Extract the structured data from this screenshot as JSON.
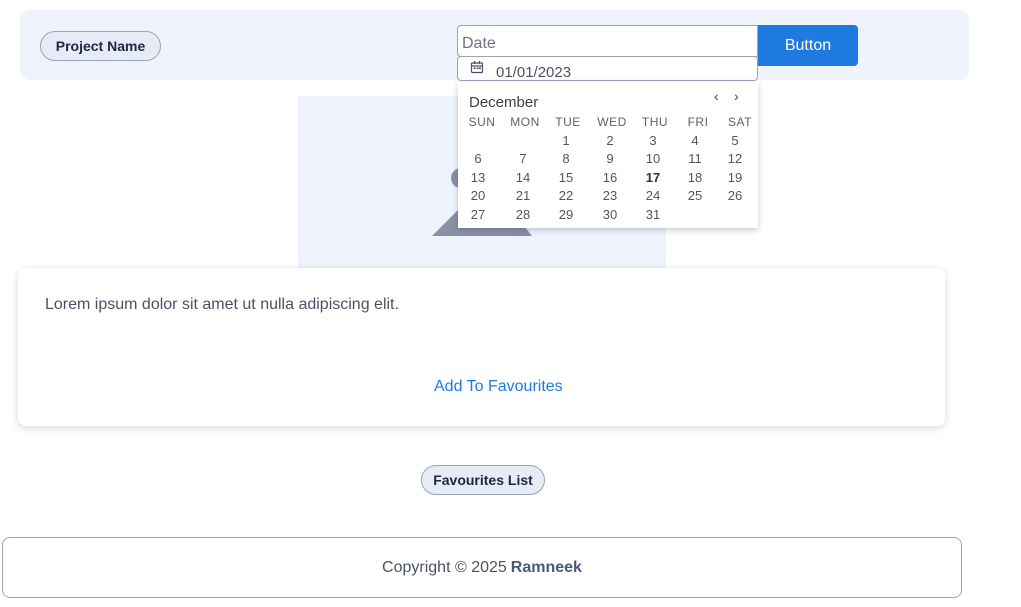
{
  "header": {
    "project_name": "Project Name",
    "date_placeholder": "Date",
    "button_label": "Button"
  },
  "date_picker": {
    "value": "01/01/2023",
    "month": "December",
    "prev_icon": "chevron-left-icon",
    "next_icon": "chevron-right-icon",
    "weekdays": [
      "SUN",
      "MON",
      "TUE",
      "WED",
      "THU",
      "FRI",
      "SAT"
    ],
    "days": [
      "1",
      "2",
      "3",
      "4",
      "5",
      "6",
      "7",
      "8",
      "9",
      "10",
      "11",
      "12",
      "13",
      "14",
      "15",
      "16",
      "17",
      "18",
      "19",
      "20",
      "21",
      "22",
      "23",
      "24",
      "25",
      "26",
      "27",
      "28",
      "29",
      "30",
      "31"
    ],
    "first_weekday_index": 2,
    "today": "17"
  },
  "card": {
    "text": "Lorem ipsum dolor sit amet ut nulla adipiscing elit.",
    "action": "Add To Favourites"
  },
  "favourites": {
    "label": "Favourites List"
  },
  "footer": {
    "prefix": "Copyright © 2025",
    "author": "Ramneek"
  },
  "colors": {
    "accent": "#1f7ae0",
    "header_bg": "#eff4fc",
    "chip_bg": "#e6ebf6"
  }
}
